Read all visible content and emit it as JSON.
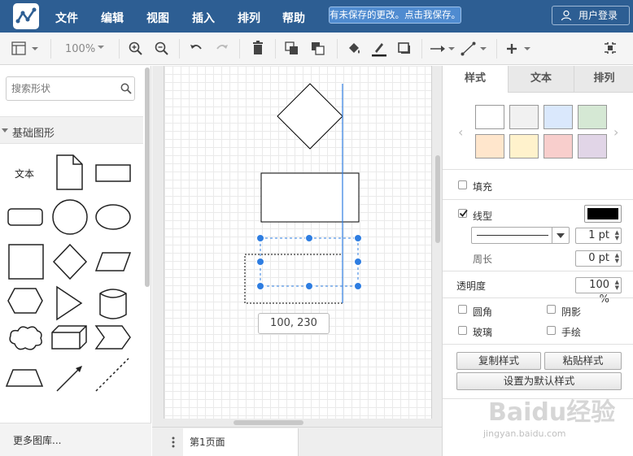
{
  "menu": {
    "items": [
      "文件",
      "编辑",
      "视图",
      "插入",
      "排列",
      "帮助"
    ],
    "unsaved_notice": "有未保存的更改。点击我保存。",
    "login": "用户登录"
  },
  "toolbar": {
    "zoom": "100%"
  },
  "left_panel": {
    "search_placeholder": "搜索形状",
    "library_title": "基础图形",
    "text_shape_label": "文本",
    "more_libraries": "更多图库..."
  },
  "canvas": {
    "coord_tooltip": "100, 230"
  },
  "footer": {
    "page_tab": "第1页面"
  },
  "right_panel": {
    "tabs": [
      "样式",
      "文本",
      "排列"
    ],
    "fill_label": "填充",
    "line_label": "线型",
    "line_width": "1 pt",
    "perimeter_label": "周长",
    "perimeter_value": "0 pt",
    "opacity_label": "透明度",
    "opacity_value": "100 %",
    "rounded_label": "圆角",
    "shadow_label": "阴影",
    "glass_label": "玻璃",
    "sketch_label": "手绘",
    "copy_style": "复制样式",
    "paste_style": "粘贴样式",
    "set_default_style": "设置为默认样式",
    "swatch_colors": [
      "#ffffff",
      "#f1f1f1",
      "#dae8fc",
      "#d5e8d4",
      "#ffe6cc",
      "#fff2cc",
      "#f8cecc",
      "#e1d5e7"
    ],
    "line_color": "#000000"
  },
  "watermark": {
    "brand": "Baidu经验",
    "url": "jingyan.baidu.com"
  },
  "colors": {
    "header_bg": "#2d5e93",
    "selection": "#2e7de1"
  }
}
